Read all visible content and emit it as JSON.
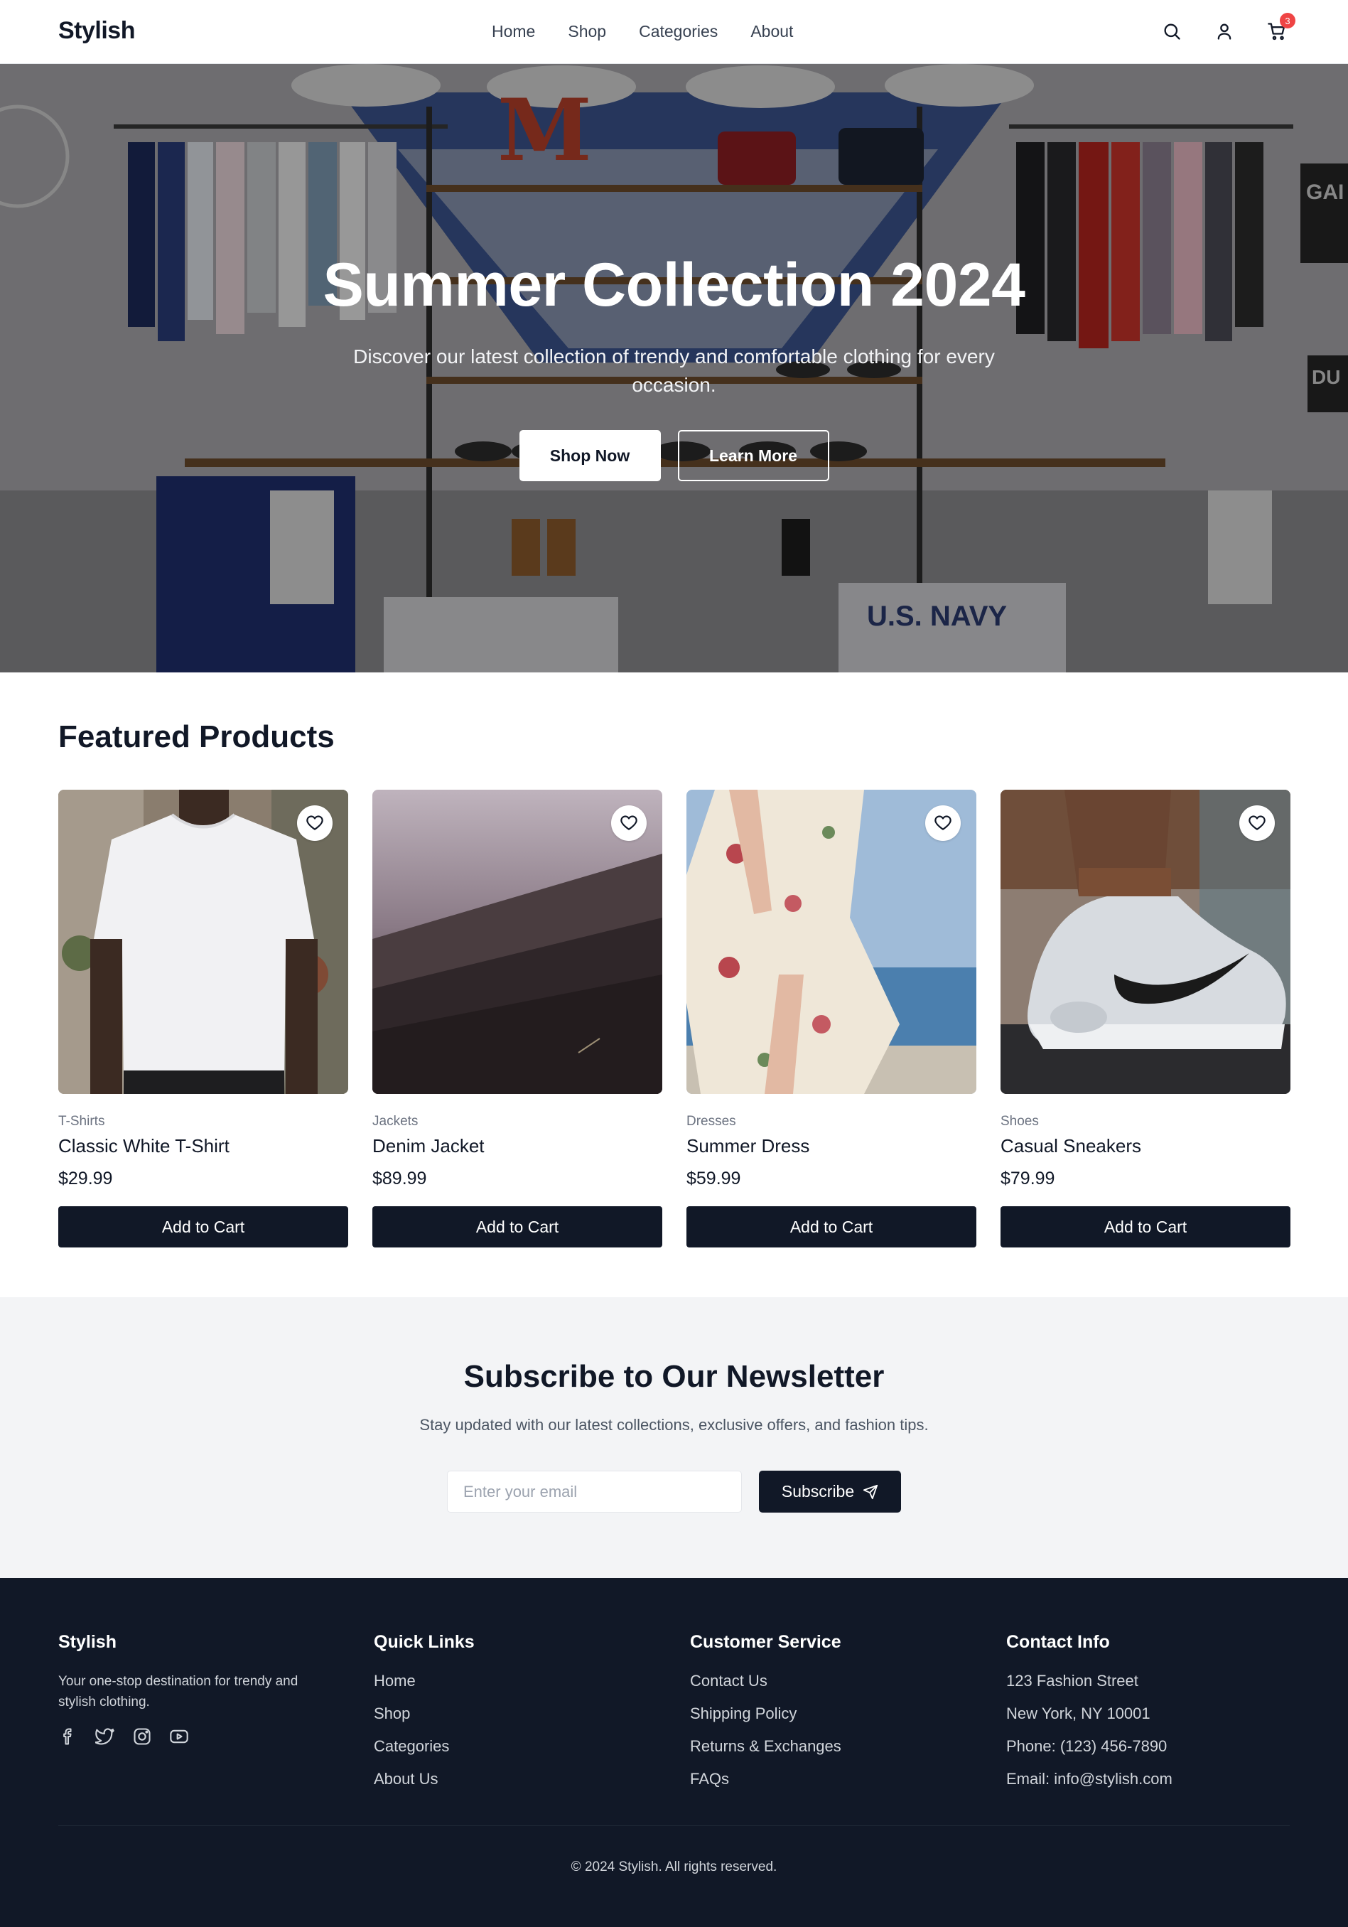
{
  "brand": "Stylish",
  "nav": {
    "items": [
      "Home",
      "Shop",
      "Categories",
      "About"
    ]
  },
  "header_icons": {
    "search": "search-icon",
    "account": "user-icon",
    "cart": "cart-icon",
    "cart_count": "3"
  },
  "hero": {
    "title": "Summer Collection 2024",
    "subtitle": "Discover our latest collection of trendy and comfortable clothing for every occasion.",
    "primary_button": "Shop Now",
    "secondary_button": "Learn More",
    "shop_signs": [
      "GAI",
      "DU",
      "U.S. NAVY",
      "M"
    ]
  },
  "featured": {
    "title": "Featured Products",
    "products": [
      {
        "category": "T-Shirts",
        "name": "Classic White T-Shirt",
        "price": "$29.99",
        "button": "Add to Cart"
      },
      {
        "category": "Jackets",
        "name": "Denim Jacket",
        "price": "$89.99",
        "button": "Add to Cart"
      },
      {
        "category": "Dresses",
        "name": "Summer Dress",
        "price": "$59.99",
        "button": "Add to Cart"
      },
      {
        "category": "Shoes",
        "name": "Casual Sneakers",
        "price": "$79.99",
        "button": "Add to Cart"
      }
    ]
  },
  "newsletter": {
    "title": "Subscribe to Our Newsletter",
    "subtitle": "Stay updated with our latest collections, exclusive offers, and fashion tips.",
    "placeholder": "Enter your email",
    "button": "Subscribe"
  },
  "footer": {
    "brand": {
      "title": "Stylish",
      "description": "Your one-stop destination for trendy and stylish clothing.",
      "socials": [
        "facebook-icon",
        "twitter-icon",
        "instagram-icon",
        "youtube-icon"
      ]
    },
    "quick_links": {
      "title": "Quick Links",
      "items": [
        "Home",
        "Shop",
        "Categories",
        "About Us"
      ]
    },
    "customer_service": {
      "title": "Customer Service",
      "items": [
        "Contact Us",
        "Shipping Policy",
        "Returns & Exchanges",
        "FAQs"
      ]
    },
    "contact": {
      "title": "Contact Info",
      "items": [
        "123 Fashion Street",
        "New York, NY 10001",
        "Phone: (123) 456-7890",
        "Email: info@stylish.com"
      ]
    },
    "copyright": "© 2024 Stylish. All rights reserved."
  },
  "colors": {
    "primary": "#111827",
    "badge": "#ef4444",
    "newsletter_bg": "#f3f4f6",
    "footer_bg": "#111827"
  }
}
